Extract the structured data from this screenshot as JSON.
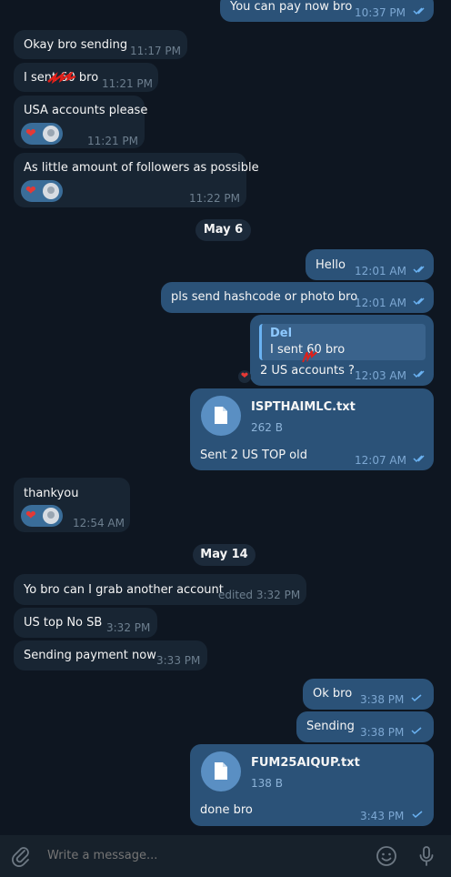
{
  "messages": [
    {
      "text": "You can pay now bro",
      "time": "10:37 PM"
    },
    {
      "text": "Okay bro sending",
      "time": "11:17 PM"
    },
    {
      "text": "I sent 60 bro",
      "time": "11:21 PM"
    },
    {
      "text": "USA accounts please",
      "time": "11:21 PM"
    },
    {
      "text": "As little amount of followers as possible",
      "time": "11:22 PM"
    },
    {
      "text": "Hello",
      "time": "12:01 AM"
    },
    {
      "text": "pls send hashcode or photo bro",
      "time": "12:01 AM"
    },
    {
      "text": "2 US accounts ?",
      "time": "12:03 AM",
      "reply_name": "Del",
      "reply_text": "I sent 60 bro"
    },
    {
      "text": "Sent 2 US TOP old",
      "time": "12:07 AM",
      "file_name": "ISPTHAIMLC.txt",
      "file_size": "262 B"
    },
    {
      "text": "thankyou",
      "time": "12:54 AM"
    },
    {
      "text": "Yo bro can I grab another account",
      "time": "edited 3:32 PM"
    },
    {
      "text": "US top No SB",
      "time": "3:32 PM"
    },
    {
      "text": "Sending payment now",
      "time": "3:33 PM"
    },
    {
      "text": "Ok bro",
      "time": "3:38 PM"
    },
    {
      "text": "Sending",
      "time": "3:38 PM"
    },
    {
      "text": "done bro",
      "time": "3:43 PM",
      "file_name": "FUM25AIQUP.txt",
      "file_size": "138 B"
    }
  ],
  "dates": [
    "May 6",
    "May 14"
  ],
  "reaction": {
    "emoji": "❤"
  },
  "input": {
    "placeholder": "Write a message..."
  },
  "colors": {
    "background": "#0e1621",
    "incoming": "#182533",
    "outgoing": "#2b5278",
    "read_ticks": "#6ab2f2"
  }
}
